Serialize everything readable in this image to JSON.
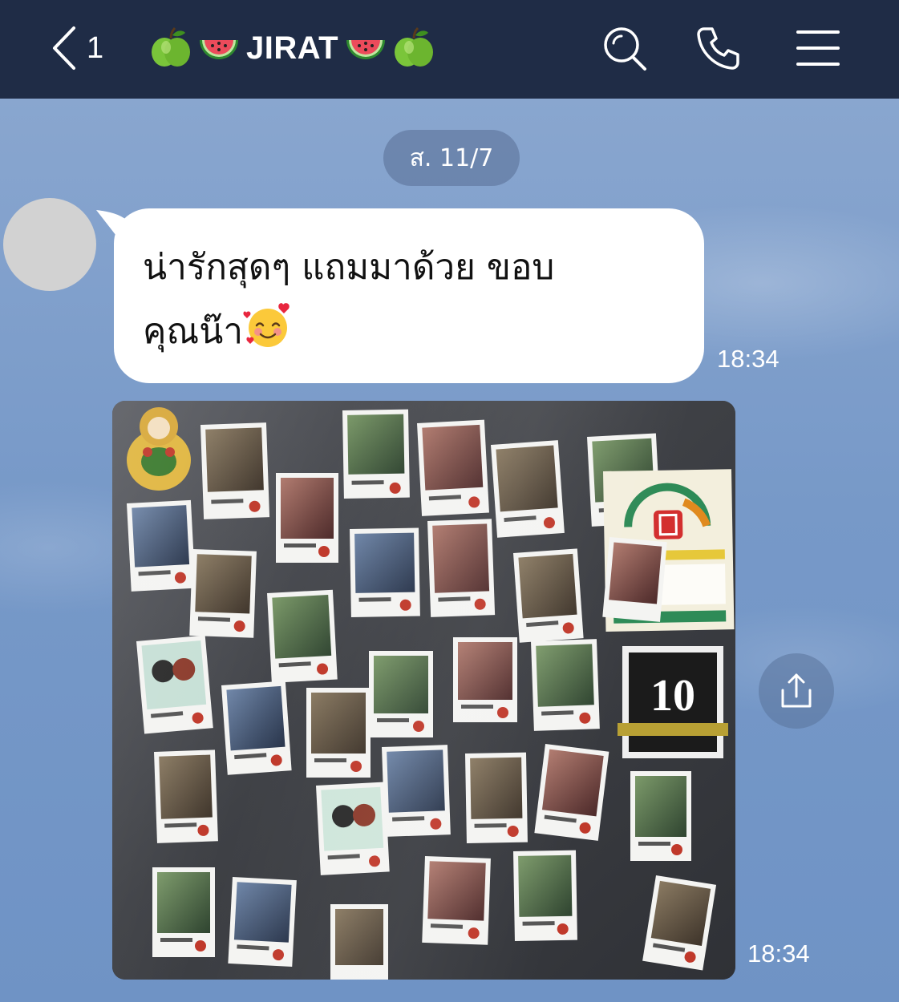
{
  "header": {
    "back_count": "1",
    "chat_name": "JIRAT",
    "name_decor_left": [
      "green-apple-icon",
      "watermelon-icon"
    ],
    "name_decor_right": [
      "watermelon-icon",
      "green-apple-icon"
    ],
    "actions": [
      "search-icon",
      "phone-icon",
      "menu-icon"
    ],
    "background_color": "#1f2c46"
  },
  "chat": {
    "date_label": "ส. 11/7",
    "messages": [
      {
        "type": "text",
        "text": "น่ารักสุดๆ แถมมาด้วย ขอบ\nคุณน๊า",
        "emoji": "smiling-face-with-hearts-icon",
        "time": "18:34"
      },
      {
        "type": "image",
        "image_description_icon": "photo-of-magnets-on-refrigerator",
        "time": "18:34"
      }
    ],
    "background_color": "#7c9cc7",
    "bubble_color": "#ffffff"
  }
}
